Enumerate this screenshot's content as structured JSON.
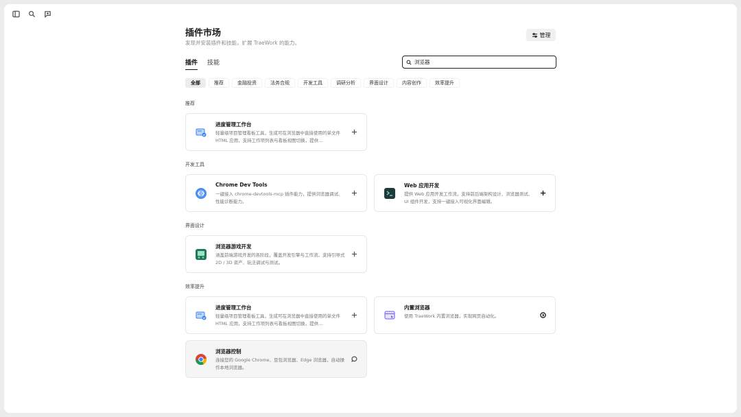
{
  "page": {
    "title": "插件市场",
    "subtitle": "发现并安装插件和技能，扩展 TraeWork 的能力。",
    "manage_label": "管理"
  },
  "tabs": [
    {
      "label": "插件",
      "active": true
    },
    {
      "label": "技能",
      "active": false
    }
  ],
  "search": {
    "value": "浏览器"
  },
  "categories": [
    {
      "label": "全部",
      "active": true
    },
    {
      "label": "推荐"
    },
    {
      "label": "金融投资"
    },
    {
      "label": "法务合规"
    },
    {
      "label": "开发工具"
    },
    {
      "label": "调研分析"
    },
    {
      "label": "界面设计"
    },
    {
      "label": "内容创作"
    },
    {
      "label": "效率提升"
    }
  ],
  "sections": {
    "recommended": "推荐",
    "devtools": "开发工具",
    "design": "界面设计",
    "efficiency": "效率提升"
  },
  "cards": {
    "progress1": {
      "title": "进度管理工作台",
      "desc": "轻量级项目管理看板工具，生成可在浏览器中直接使用的单文件 HTML 应用，支持工作项列表与看板视图切换，提供…",
      "icon": "progress-board-icon",
      "action": "add"
    },
    "chrome_dev": {
      "title": "Chrome Dev Tools",
      "desc": "一键接入 chrome-devtools-mcp 插件能力，提供浏览器调试、性能诊断能力。",
      "icon": "chrome-devtools-icon",
      "action": "add"
    },
    "webdev": {
      "title": "Web 应用开发",
      "desc": "提供 Web 应用开发工作流，支持前后端架构设计、浏览器测试、UI 组件开发，支持一键接入可视化界面编辑。",
      "icon": "terminal-icon",
      "action": "add"
    },
    "game": {
      "title": "浏览器游戏开发",
      "desc": "涵盖前端游戏开发的各阶段，覆盖开发引擎与工作流，支持引导式 2D / 3D 资产、玩法调试与测试。",
      "icon": "game-icon",
      "action": "add"
    },
    "progress2": {
      "title": "进度管理工作台",
      "desc": "轻量级项目管理看板工具，生成可在浏览器中直接使用的单文件 HTML 应用，支持工作项列表与看板视图切换，提供…",
      "icon": "progress-board-icon",
      "action": "add"
    },
    "builtin_browser": {
      "title": "内置浏览器",
      "desc": "使用 TraeWork 内置浏览器，实现网页自动化。",
      "icon": "browser-window-icon",
      "action": "installed"
    },
    "browser_ctrl": {
      "title": "浏览器控制",
      "desc": "连接您的 Google Chrome、豆包浏览器、Edge 浏览器，自动操作本地浏览器。",
      "icon": "chrome-icon",
      "action": "installed"
    }
  },
  "colors": {
    "accent_blue": "#3b82f6",
    "game_green": "#1f7a5a",
    "terminal_dark": "#1e3a3a"
  }
}
